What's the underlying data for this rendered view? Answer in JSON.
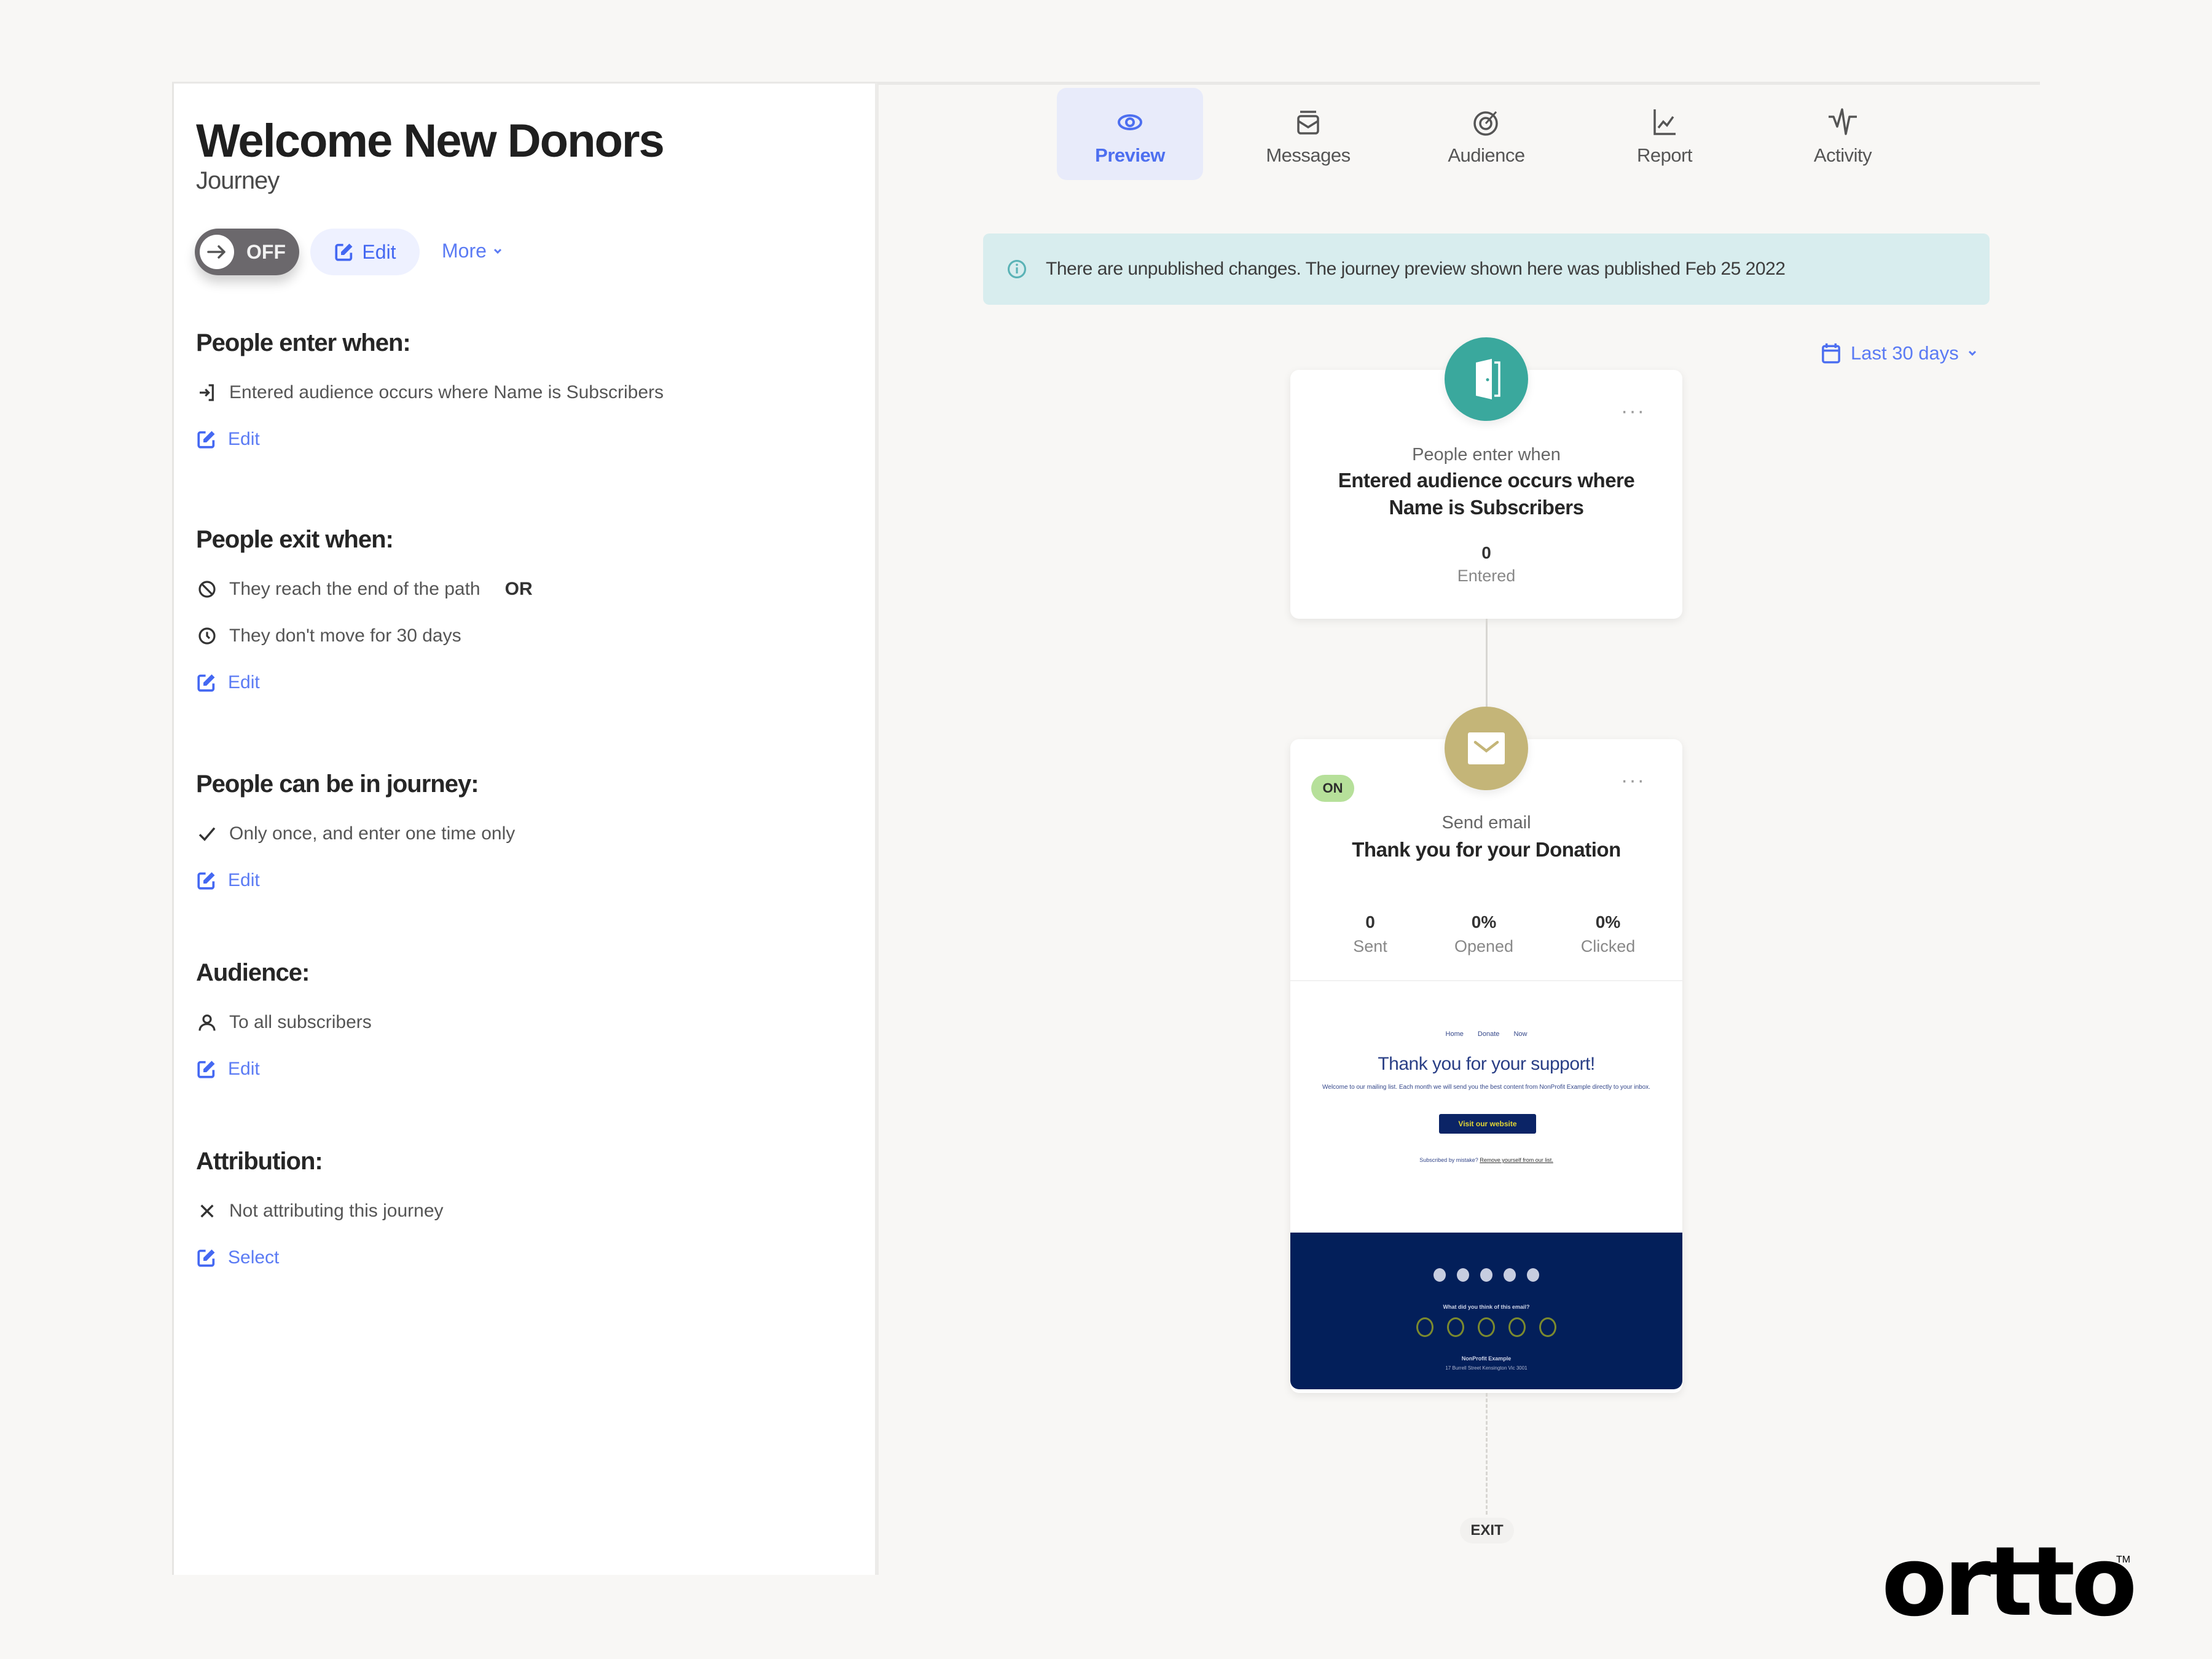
{
  "journey": {
    "title": "Welcome New Donors",
    "type_label": "Journey",
    "status_toggle": "OFF",
    "edit_label": "Edit",
    "more_label": "More"
  },
  "sections": {
    "enter": {
      "heading": "People enter when:",
      "items": [
        {
          "icon": "enter-door-icon",
          "text": "Entered audience occurs where Name is Subscribers"
        }
      ],
      "action": "Edit"
    },
    "exit": {
      "heading": "People exit when:",
      "items": [
        {
          "icon": "block-icon",
          "text": "They reach the end of the path",
          "suffix": "OR"
        },
        {
          "icon": "clock-icon",
          "text": "They don't move for 30 days"
        }
      ],
      "action": "Edit"
    },
    "frequency": {
      "heading": "People can be in journey:",
      "items": [
        {
          "icon": "check-icon",
          "text": "Only once, and enter one time only"
        }
      ],
      "action": "Edit"
    },
    "audience": {
      "heading": "Audience:",
      "items": [
        {
          "icon": "person-icon",
          "text": "To all subscribers"
        }
      ],
      "action": "Edit"
    },
    "attribution": {
      "heading": "Attribution:",
      "items": [
        {
          "icon": "x-icon",
          "text": "Not attributing this journey"
        }
      ],
      "action": "Select"
    }
  },
  "tabs": [
    {
      "label": "Preview",
      "icon": "eye-icon",
      "active": true
    },
    {
      "label": "Messages",
      "icon": "inbox-icon",
      "active": false
    },
    {
      "label": "Audience",
      "icon": "target-icon",
      "active": false
    },
    {
      "label": "Report",
      "icon": "chart-icon",
      "active": false
    },
    {
      "label": "Activity",
      "icon": "pulse-icon",
      "active": false
    }
  ],
  "banner": {
    "icon": "info-icon",
    "text": "There are unpublished changes. The journey preview shown here was published Feb 25 2022"
  },
  "date_range": {
    "icon": "calendar-icon",
    "label": "Last 30 days"
  },
  "nodes": {
    "entry": {
      "caption": "People enter when",
      "title": "Entered audience occurs where Name is Subscribers",
      "stat_value": "0",
      "stat_label": "Entered",
      "menu": "···"
    },
    "email": {
      "status": "ON",
      "caption": "Send email",
      "title": "Thank you for your Donation",
      "menu": "···",
      "stats": [
        {
          "value": "0",
          "label": "Sent"
        },
        {
          "value": "0%",
          "label": "Opened"
        },
        {
          "value": "0%",
          "label": "Clicked"
        }
      ],
      "preview": {
        "nav": "Home Donate Now",
        "headline": "Thank you for your support!",
        "body": "Welcome to our mailing list. Each month we will send you the best content from NonProfit Example directly to your inbox.",
        "button": "Visit our website",
        "footer_text": "Subscribed by mistake?",
        "footer_link": "Remove yourself from our list.",
        "feedback_question": "What did you think of this email?",
        "org_name": "NonProfit Example",
        "address": "17 Burrell Street Kensington Vic 3001"
      }
    },
    "exit_label": "EXIT"
  },
  "brand": {
    "logo_text": "ortto",
    "trademark": "TM"
  },
  "colors": {
    "accent": "#4d6ff0",
    "entry_node": "#3aa89d",
    "email_node": "#c4b578",
    "banner_bg": "#d8edee",
    "email_footer": "#031f5a"
  }
}
